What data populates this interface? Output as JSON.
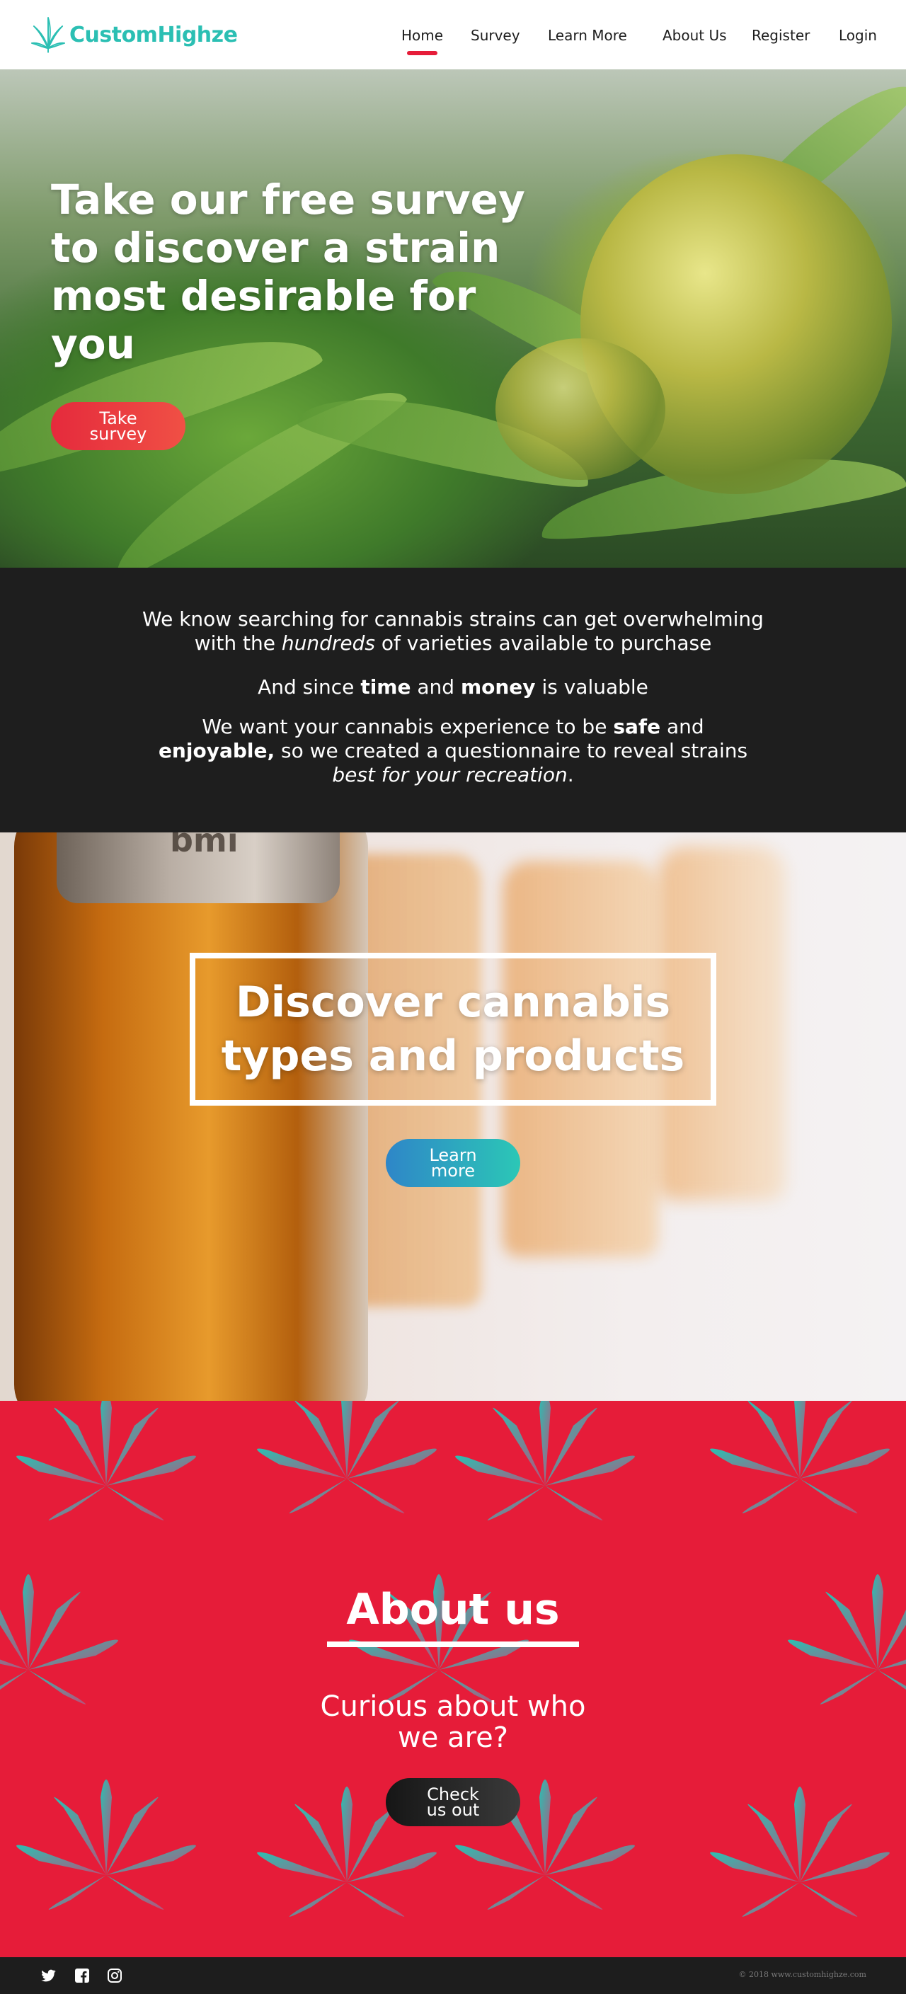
{
  "brand": {
    "name": "CustomHighze",
    "color": "#2bbfb3",
    "icon": "cannabis-leaf-icon"
  },
  "nav": {
    "items": [
      {
        "label": "Home",
        "active": true
      },
      {
        "label": "Survey"
      },
      {
        "label": "Learn More"
      },
      {
        "label": "About Us"
      },
      {
        "label": "Register"
      },
      {
        "label": "Login"
      }
    ],
    "active_color": "#e61c39"
  },
  "hero": {
    "title_lines": [
      "Take our free survey",
      "to discover a strain",
      "most desirable for you"
    ],
    "button_lines": [
      "Take",
      "survey"
    ]
  },
  "info": {
    "p1_a": "We know searching for cannabis strains can get overwhelming",
    "p1_b": "with the ",
    "p1_em": "hundreds",
    "p1_c": " of varieties available to purchase",
    "p2_a": "And since ",
    "p2_b1": "time",
    "p2_c": " and ",
    "p2_b2": "money",
    "p2_d": " is valuable",
    "p3_a": "We want your cannabis experience to be ",
    "p3_b1": "safe",
    "p3_c": " and",
    "p3_b2": "enjoyable,",
    "p3_d": " so we created a questionnaire to reveal strains",
    "p3_em": "best for your recreation",
    "p3_e": "."
  },
  "products": {
    "title_lines": [
      "Discover cannabis",
      "types and products"
    ],
    "button_lines": [
      "Learn",
      "more"
    ],
    "jar_label": "bmi"
  },
  "about": {
    "title": "About us",
    "subtitle_lines": [
      "Curious about who",
      "we are?"
    ],
    "button_lines": [
      "Check",
      "us out"
    ],
    "background": "#e61c39"
  },
  "footer": {
    "social": [
      "twitter-icon",
      "facebook-icon",
      "instagram-icon"
    ],
    "copyright": "© 2018 www.customhighze.com"
  }
}
